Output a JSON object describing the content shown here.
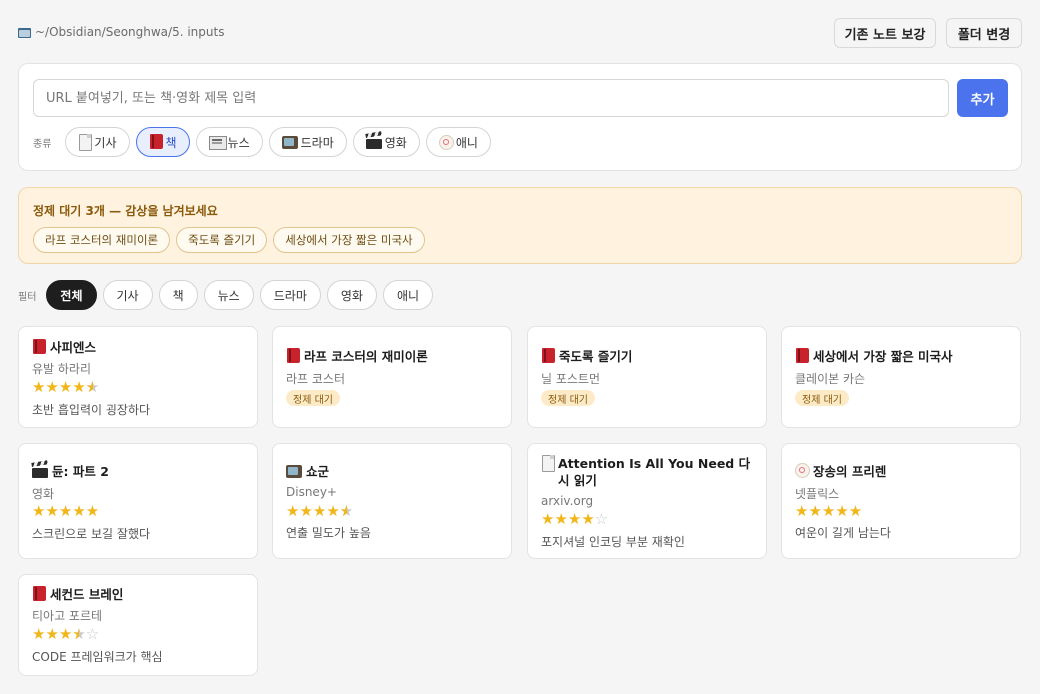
{
  "header": {
    "path": "~/Obsidian/Seonghwa/5. inputs",
    "salvage_button": "기존 노트 보강",
    "change_folder_button": "폴더 변경"
  },
  "input": {
    "placeholder": "URL 붙여넣기, 또는 책·영화 제목 입력",
    "add_button": "추가",
    "type_label": "종류",
    "types": [
      {
        "label": "기사",
        "icon": "document-icon"
      },
      {
        "label": "책",
        "icon": "book-icon",
        "selected": true
      },
      {
        "label": "뉴스",
        "icon": "newspaper-icon"
      },
      {
        "label": "드라마",
        "icon": "tv-icon"
      },
      {
        "label": "영화",
        "icon": "clapperboard-icon"
      },
      {
        "label": "애니",
        "icon": "naruto-icon"
      }
    ]
  },
  "pending": {
    "title": "정제 대기 3개 — 감상을 남겨보세요",
    "items": [
      "라프 코스터의 재미이론",
      "죽도록 즐기기",
      "세상에서 가장 짧은 미국사"
    ]
  },
  "filter": {
    "label": "필터",
    "options": [
      "전체",
      "기사",
      "책",
      "뉴스",
      "드라마",
      "영화",
      "애니"
    ],
    "active": "전체"
  },
  "cards": [
    {
      "title": "사피엔스",
      "sub": "유발 하라리",
      "rating": 4.5,
      "note": "초반 흡입력이 굉장하다",
      "icon": "book-icon"
    },
    {
      "title": "라프 코스터의 재미이론",
      "sub": "라프 코스터",
      "badge": "정제 대기",
      "icon": "book-icon"
    },
    {
      "title": "죽도록 즐기기",
      "sub": "닐 포스트먼",
      "badge": "정제 대기",
      "icon": "book-icon"
    },
    {
      "title": "세상에서 가장 짧은 미국사",
      "sub": "클레이본 카슨",
      "badge": "정제 대기",
      "icon": "book-icon"
    },
    {
      "title": "듄: 파트 2",
      "sub": "영화",
      "rating": 5,
      "note": "스크린으로 보길 잘했다",
      "icon": "clapperboard-icon"
    },
    {
      "title": "쇼군",
      "sub": "Disney+",
      "rating": 4.5,
      "note": "연출 밀도가 높음",
      "icon": "tv-icon"
    },
    {
      "title": "Attention Is All You Need 다시 읽기",
      "sub": "arxiv.org",
      "rating": 4,
      "note": "포지셔널 인코딩 부분 재확인",
      "icon": "document-icon"
    },
    {
      "title": "장송의 프리렌",
      "sub": "넷플릭스",
      "rating": 5,
      "note": "여운이 길게 남는다",
      "icon": "naruto-icon"
    },
    {
      "title": "세컨드 브레인",
      "sub": "티아고 포르테",
      "rating": 3.5,
      "note": "CODE 프레임워크가 핵심",
      "icon": "book-icon"
    }
  ]
}
